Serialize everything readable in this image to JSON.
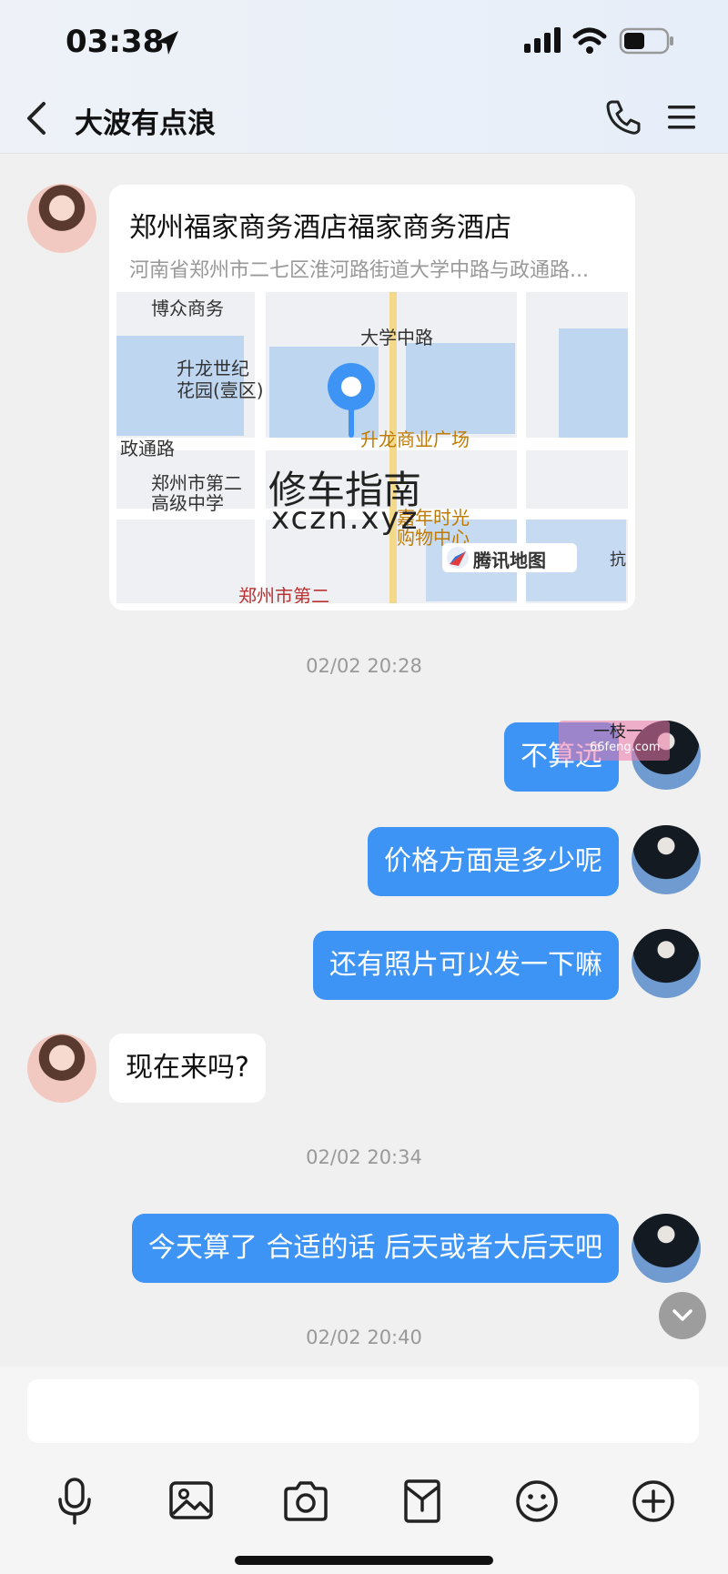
{
  "status_bar": {
    "time": "03:38"
  },
  "header": {
    "title": "大波有点浪"
  },
  "location_card": {
    "title": "郑州福家商务酒店福家商务酒店",
    "address": "河南省郑州市二七区淮河路街道大学中路与政通路...",
    "map_labels": [
      "博众商务",
      "大学中路",
      "升龙世纪",
      "花园(壹区)",
      "升龙商业广场",
      "政通路",
      "郑州市第二",
      "高级中学",
      "嘉年时光",
      "购物中心",
      "郑州市第二",
      "腾讯地图",
      "抗"
    ],
    "watermark_line1": "修车指南",
    "watermark_line2": "xczn.xyz"
  },
  "messages": [
    {
      "kind": "timestamp",
      "text": "02/02 20:28"
    },
    {
      "kind": "me",
      "text": "不算远"
    },
    {
      "kind": "me",
      "text": "价格方面是多少呢"
    },
    {
      "kind": "me",
      "text": "还有照片可以发一下嘛"
    },
    {
      "kind": "her",
      "text": "现在来吗?"
    },
    {
      "kind": "timestamp",
      "text": "02/02 20:34"
    },
    {
      "kind": "me",
      "text": "今天算了 合适的话 后天或者大后天吧"
    },
    {
      "kind": "timestamp",
      "text": "02/02 20:40"
    }
  ],
  "sticker_watermark": {
    "text": "66feng.com",
    "glyphs": "一枝一"
  },
  "toolbar": {
    "icons": [
      "microphone-icon",
      "image-icon",
      "camera-icon",
      "red-packet-icon",
      "emoji-icon",
      "plus-icon"
    ]
  },
  "colors": {
    "bubble_blue": "#3d94f4",
    "background": "#f0f0f0"
  }
}
